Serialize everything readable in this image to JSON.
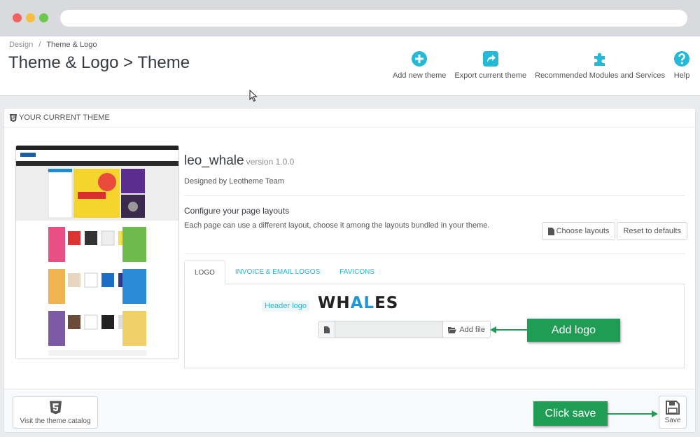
{
  "breadcrumb": {
    "parent": "Design",
    "current": "Theme & Logo"
  },
  "page_title": "Theme & Logo > Theme",
  "toolbar": {
    "add_new_theme": "Add new theme",
    "export_theme": "Export current theme",
    "recommended": "Recommended Modules and Services",
    "help": "Help"
  },
  "panel": {
    "title": "Your current theme"
  },
  "theme": {
    "name": "leo_whale",
    "version": "version 1.0.0",
    "designed_by": "Designed by Leotheme Team",
    "configure_title": "Configure your page layouts",
    "configure_desc": "Each page can use a different layout, choose it among the layouts bundled in your theme.",
    "choose_layouts": "Choose layouts",
    "reset_defaults": "Reset to defaults"
  },
  "tabs": [
    {
      "label": "Logo",
      "active": true
    },
    {
      "label": "Invoice & Email logos",
      "active": false
    },
    {
      "label": "Favicons",
      "active": false
    }
  ],
  "logo_tab": {
    "header_logo_label": "Header logo",
    "logo_text_a": "WH",
    "logo_text_b": "AL",
    "logo_text_c": "ES",
    "add_file": "Add file"
  },
  "footer": {
    "visit_catalog": "Visit the theme catalog",
    "save": "Save"
  },
  "callouts": {
    "add_logo": "Add logo",
    "click_save": "Click save"
  },
  "colors": {
    "accent": "#25b9d7",
    "callout": "#1f9d55",
    "logo_blue": "#2196d7"
  }
}
